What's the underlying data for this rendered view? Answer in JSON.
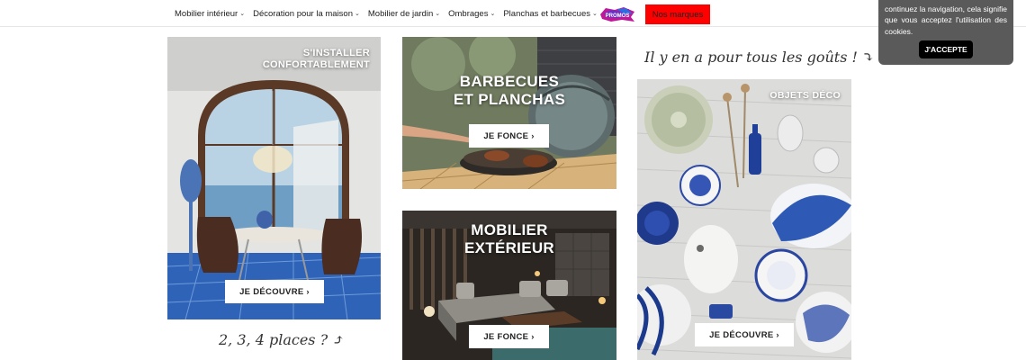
{
  "nav": {
    "items": [
      {
        "label": "Mobilier intérieur"
      },
      {
        "label": "Décoration pour la maison"
      },
      {
        "label": "Mobilier de jardin"
      },
      {
        "label": "Ombrages"
      },
      {
        "label": "Planchas et barbecues"
      }
    ],
    "promo_label": "PROMOS",
    "brands_label": "Nos marques"
  },
  "cards": {
    "interior": {
      "title_line1": "S'INSTALLER",
      "title_line2": "CONFORTABLEMENT",
      "cta": "JE DÉCOUVRE ›"
    },
    "bbq": {
      "title_line1": "BARBECUES",
      "title_line2": "ET PLANCHAS",
      "cta": "JE FONCE ›"
    },
    "outdoor": {
      "title_line1": "MOBILIER",
      "title_line2": "EXTÉRIEUR",
      "cta": "JE FONCE ›"
    },
    "deco": {
      "title": "OBJETS DÉCO",
      "cta": "JE DÉCOUVRE ›"
    }
  },
  "handwritten": {
    "tastes": "Il y en a pour tous les goûts ! ⤵",
    "places": "2, 3, 4 places ? ⤴"
  },
  "cookie": {
    "text": "continuez la navigation, cela signifie que vous acceptez l'utilisation des cookies.",
    "button": "J'ACCEPTE"
  }
}
